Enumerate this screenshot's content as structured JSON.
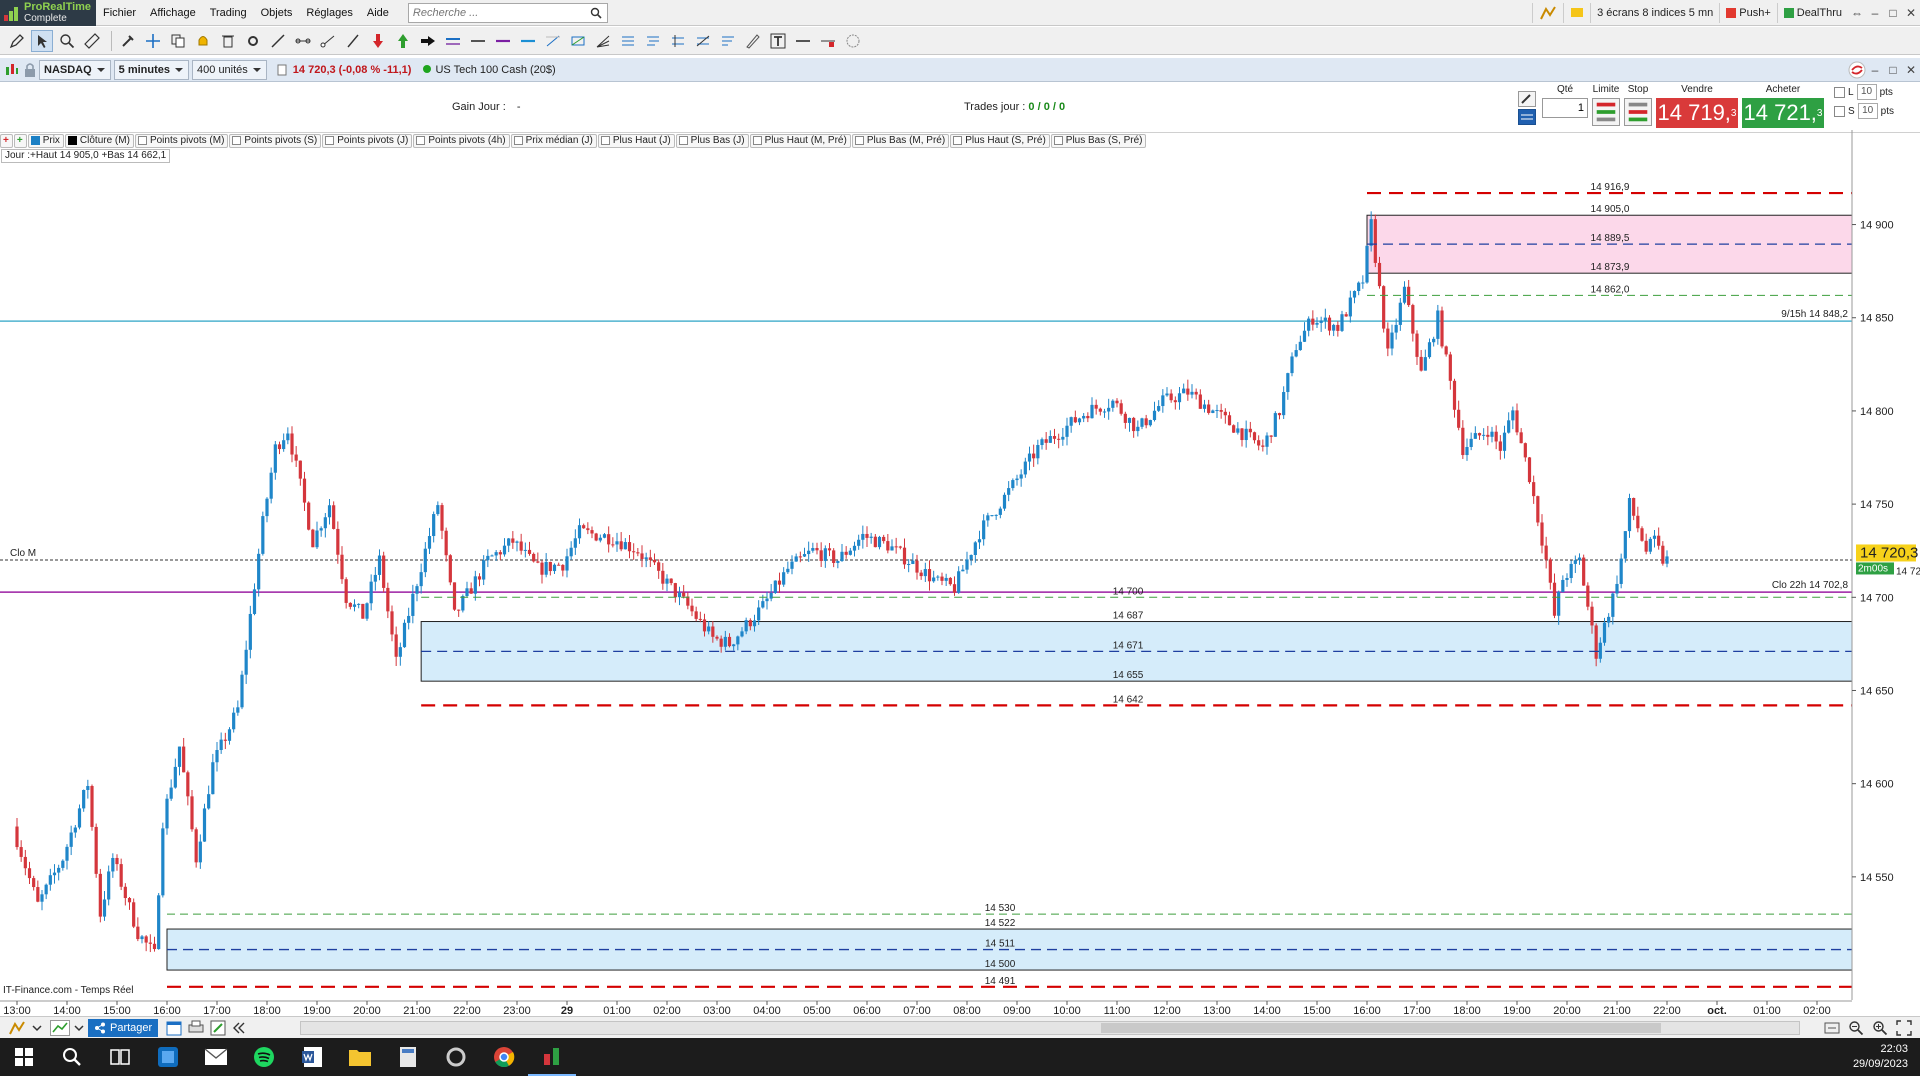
{
  "app": {
    "logo_title": "ProRealTime",
    "logo_subtitle": "Complete",
    "menu": [
      "Fichier",
      "Affichage",
      "Trading",
      "Objets",
      "Réglages",
      "Aide"
    ],
    "search_placeholder": "Recherche ...",
    "workspace": "3 écrans 8 indices 5 mn",
    "push_label": "Push+",
    "dealthru_label": "DealThru"
  },
  "instrument": {
    "market": "NASDAQ",
    "timeframe": "5 minutes",
    "units": "400 unités",
    "quote": "14 720,3 (-0,08 % -11,1)",
    "name": "US Tech 100 Cash (20$)"
  },
  "trading": {
    "gain_label": "Gain Jour :",
    "gain_value": "-",
    "trades_label": "Trades jour :",
    "trades_value": "0 / 0 / 0",
    "qty_label": "Qté",
    "qty_value": "1",
    "limit_label": "Limite",
    "stop_label": "Stop",
    "sell_label": "Vendre",
    "sell_price": "14 719,",
    "sell_sup": "3",
    "buy_label": "Acheter",
    "buy_price": "14 721,",
    "buy_sup": "3",
    "l_label": "L",
    "s_label": "S",
    "l_value": "10",
    "s_value": "10",
    "pts": "pts"
  },
  "legend": [
    "Prix",
    "Clôture (M)",
    "Points pivots (M)",
    "Points pivots (S)",
    "Points pivots (J)",
    "Points pivots (4h)",
    "Prix médian (J)",
    "Plus Haut (J)",
    "Plus Bas (J)",
    "Plus Haut (M, Pré)",
    "Plus Bas (M, Pré)",
    "Plus Haut (S, Pré)",
    "Plus Bas (S, Pré)"
  ],
  "day_info": "Jour :+Haut 14 905,0 +Bas 14 662,1",
  "chart_data": {
    "type": "candlestick",
    "y_ticks": [
      14900,
      14850,
      14800,
      14750,
      14700,
      14650,
      14600,
      14550
    ],
    "y_tick_labels": [
      "14 900",
      "14 850",
      "14 800",
      "14 750",
      "14 700",
      "14 650",
      "14 600",
      "14 550"
    ],
    "ylim": [
      14485,
      14940
    ],
    "x_tick_labels": [
      "13:00",
      "14:00",
      "15:00",
      "16:00",
      "17:00",
      "18:00",
      "19:00",
      "20:00",
      "21:00",
      "22:00",
      "23:00",
      "29",
      "01:00",
      "02:00",
      "03:00",
      "04:00",
      "05:00",
      "06:00",
      "07:00",
      "08:00",
      "09:00",
      "10:00",
      "11:00",
      "12:00",
      "13:00",
      "14:00",
      "15:00",
      "16:00",
      "17:00",
      "18:00",
      "19:00",
      "20:00",
      "21:00",
      "22:00",
      "oct.",
      "01:00",
      "02:00"
    ],
    "current_price": "14 720,3",
    "countdown": "2m00s",
    "current_price_small": "14 720,3",
    "close_anchors": [
      [
        "13:00",
        14577
      ],
      [
        "13:30",
        14535
      ],
      [
        "14:00",
        14560
      ],
      [
        "14:30",
        14600
      ],
      [
        "14:45",
        14530
      ],
      [
        "15:00",
        14560
      ],
      [
        "15:30",
        14520
      ],
      [
        "15:50",
        14508
      ],
      [
        "16:00",
        14580
      ],
      [
        "16:20",
        14620
      ],
      [
        "16:40",
        14560
      ],
      [
        "17:00",
        14610
      ],
      [
        "17:30",
        14640
      ],
      [
        "17:45",
        14690
      ],
      [
        "18:00",
        14740
      ],
      [
        "18:15",
        14780
      ],
      [
        "18:30",
        14790
      ],
      [
        "19:00",
        14730
      ],
      [
        "19:20",
        14750
      ],
      [
        "19:40",
        14700
      ],
      [
        "20:00",
        14690
      ],
      [
        "20:20",
        14720
      ],
      [
        "20:40",
        14665
      ],
      [
        "21:00",
        14700
      ],
      [
        "21:30",
        14750
      ],
      [
        "21:50",
        14690
      ],
      [
        "22:30",
        14720
      ],
      [
        "23:00",
        14730
      ],
      [
        "23:30",
        14715
      ],
      [
        "00:00",
        14718
      ],
      [
        "00:20",
        14735
      ],
      [
        "01:00",
        14732
      ],
      [
        "01:30",
        14725
      ],
      [
        "02:00",
        14710
      ],
      [
        "02:30",
        14695
      ],
      [
        "03:00",
        14678
      ],
      [
        "03:20",
        14675
      ],
      [
        "04:00",
        14695
      ],
      [
        "04:30",
        14715
      ],
      [
        "05:00",
        14725
      ],
      [
        "05:30",
        14720
      ],
      [
        "06:00",
        14733
      ],
      [
        "06:30",
        14728
      ],
      [
        "07:00",
        14718
      ],
      [
        "07:30",
        14708
      ],
      [
        "07:50",
        14705
      ],
      [
        "08:20",
        14735
      ],
      [
        "09:00",
        14760
      ],
      [
        "09:30",
        14780
      ],
      [
        "10:00",
        14790
      ],
      [
        "10:30",
        14800
      ],
      [
        "11:00",
        14805
      ],
      [
        "11:30",
        14790
      ],
      [
        "12:00",
        14805
      ],
      [
        "12:30",
        14810
      ],
      [
        "13:00",
        14800
      ],
      [
        "13:30",
        14790
      ],
      [
        "14:00",
        14780
      ],
      [
        "14:20",
        14800
      ],
      [
        "14:40",
        14835
      ],
      [
        "15:00",
        14850
      ],
      [
        "15:30",
        14845
      ],
      [
        "16:00",
        14870
      ],
      [
        "16:10",
        14900
      ],
      [
        "16:30",
        14830
      ],
      [
        "16:50",
        14865
      ],
      [
        "17:10",
        14820
      ],
      [
        "17:30",
        14850
      ],
      [
        "18:00",
        14780
      ],
      [
        "18:30",
        14790
      ],
      [
        "18:45",
        14780
      ],
      [
        "19:00",
        14800
      ],
      [
        "19:20",
        14765
      ],
      [
        "19:40",
        14720
      ],
      [
        "19:50",
        14690
      ],
      [
        "20:00",
        14710
      ],
      [
        "20:20",
        14720
      ],
      [
        "20:40",
        14670
      ],
      [
        "21:00",
        14700
      ],
      [
        "21:10",
        14720
      ],
      [
        "21:20",
        14750
      ],
      [
        "21:40",
        14725
      ],
      [
        "21:50",
        14730
      ],
      [
        "22:00",
        14720
      ]
    ],
    "levels": [
      {
        "label": "14 916,9",
        "value": 14916.9,
        "style": "pivot-res"
      },
      {
        "label": "14 905,0",
        "value": 14905.0,
        "style": "rect-top"
      },
      {
        "label": "14 889,5",
        "value": 14889.5,
        "style": "pivot-mid"
      },
      {
        "label": "14 873,9",
        "value": 14873.9,
        "style": "rect-bottom"
      },
      {
        "label": "14 862,0",
        "value": 14862.0,
        "style": "green-dash"
      },
      {
        "label": "14 700",
        "value": 14700,
        "style": "green-dash"
      },
      {
        "label": "14 687",
        "value": 14687,
        "style": "rect-top"
      },
      {
        "label": "14 671",
        "value": 14671,
        "style": "pivot-mid"
      },
      {
        "label": "14 655",
        "value": 14655,
        "style": "rect-bottom"
      },
      {
        "label": "14 642",
        "value": 14642,
        "style": "pivot-res"
      },
      {
        "label": "14 530",
        "value": 14530,
        "style": "green-dash"
      },
      {
        "label": "14 522",
        "value": 14522,
        "style": "rect-top"
      },
      {
        "label": "14 511",
        "value": 14511,
        "style": "pivot-mid"
      },
      {
        "label": "14 500",
        "value": 14500,
        "style": "rect-bottom"
      },
      {
        "label": "14 491",
        "value": 14491,
        "style": "pivot-res"
      }
    ],
    "hlines": [
      {
        "label": "9/15h 14 848,2",
        "value": 14848.2,
        "color": "#4fb3cf"
      },
      {
        "label": "Clo 22h 14 702,8",
        "value": 14702.8,
        "color": "#9b1fa3"
      },
      {
        "label": "Clo M",
        "value": 14720,
        "color": "#333333"
      }
    ],
    "colors": {
      "up": "#1f86c9",
      "down": "#d4363c",
      "pivot_res": "#d40000",
      "pivot_mid": "#1e3fa0",
      "green": "#3d9e3d",
      "zone_blue": "#d5ecfa",
      "zone_pink": "#fcd8ea"
    }
  },
  "source_note": "IT-Finance.com - Temps Réel",
  "bottom": {
    "share_label": "Partager"
  },
  "taskbar": {
    "time": "22:03",
    "date": "29/09/2023"
  }
}
